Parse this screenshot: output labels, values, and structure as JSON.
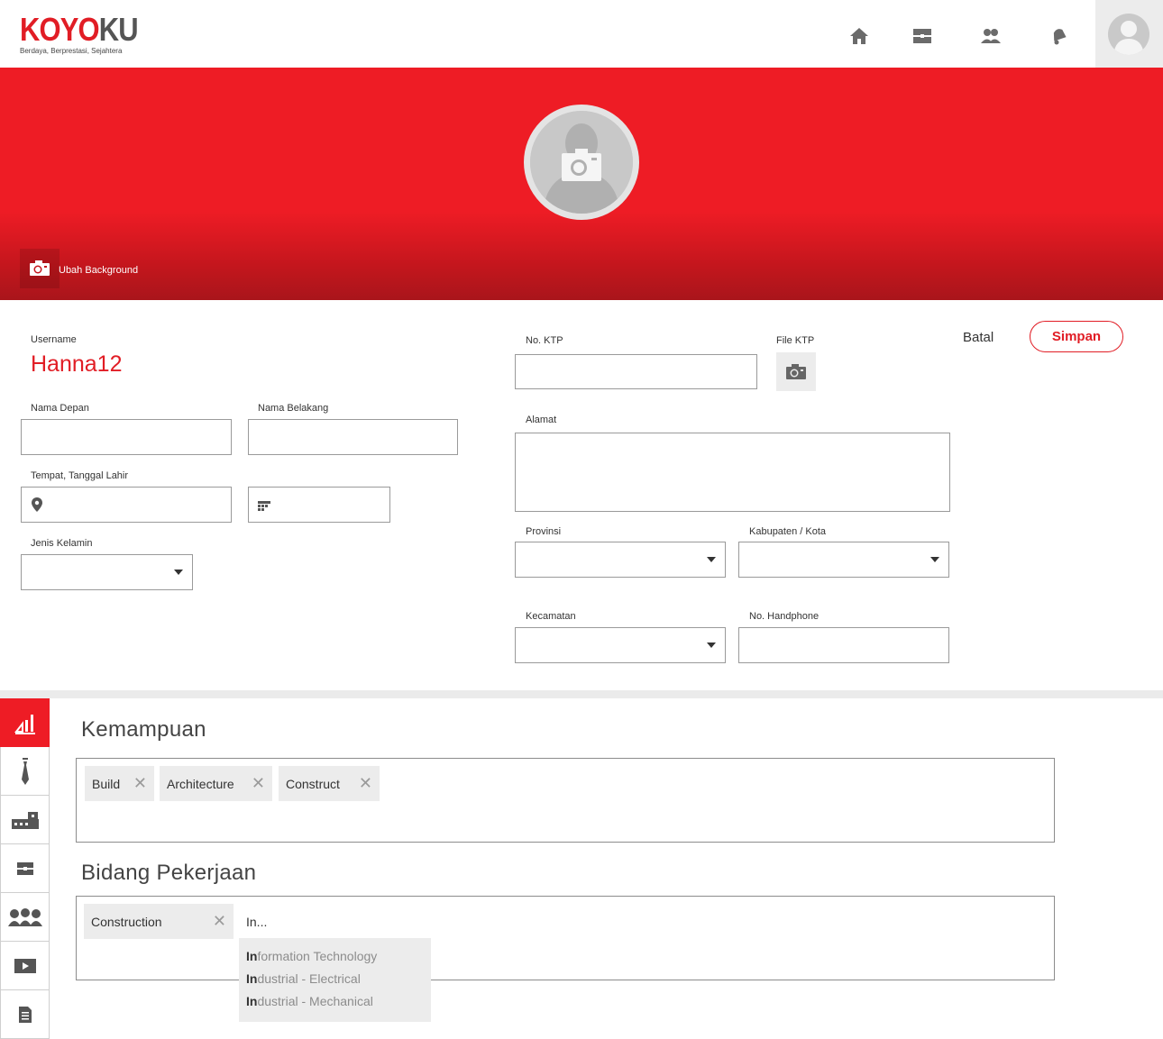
{
  "brand": {
    "logo_red": "KOYO",
    "logo_gray": "KU",
    "tagline": "Berdaya, Berprestasi, Sejahtera"
  },
  "nav": {
    "icons": [
      "home-icon",
      "jobs-icon",
      "people-icon",
      "notification-bell-icon",
      "user-avatar-icon"
    ]
  },
  "banner": {
    "change_bg_label": "Ubah Background"
  },
  "form": {
    "username_label": "Username",
    "username_value": "Hanna12",
    "first_name_label": "Nama Depan",
    "first_name_value": "",
    "last_name_label": "Nama Belakang",
    "last_name_value": "",
    "birth_label": "Tempat, Tanggal Lahir",
    "birth_place_value": "",
    "birth_date_value": "",
    "gender_label": "Jenis Kelamin",
    "gender_value": "",
    "ktp_label": "No. KTP",
    "ktp_value": "",
    "ktp_file_label": "File KTP",
    "address_label": "Alamat",
    "address_value": "",
    "province_label": "Provinsi",
    "province_value": "",
    "city_label": "Kabupaten / Kota",
    "city_value": "",
    "district_label": "Kecamatan",
    "district_value": "",
    "phone_label": "No. Handphone",
    "phone_value": ""
  },
  "actions": {
    "cancel_label": "Batal",
    "save_label": "Simpan"
  },
  "side_tabs": [
    "skills-chart-icon",
    "tie-icon",
    "building-icon",
    "briefcase-icon",
    "group-icon",
    "video-icon",
    "document-icon"
  ],
  "skills": {
    "title": "Kemampuan",
    "tags": [
      "Build",
      "Architecture",
      "Construct"
    ]
  },
  "fields": {
    "title": "Bidang Pekerjaan",
    "tags": [
      "Construction"
    ],
    "typed_text": "In...",
    "suggestions": [
      {
        "match": "In",
        "rest": "formation Technology"
      },
      {
        "match": "In",
        "rest": "dustrial - Electrical"
      },
      {
        "match": "In",
        "rest": "dustrial - Mechanical"
      }
    ]
  },
  "colors": {
    "brand_red": "#ee1c25",
    "text_red": "#e11d25",
    "panel_gray": "#ececec"
  }
}
